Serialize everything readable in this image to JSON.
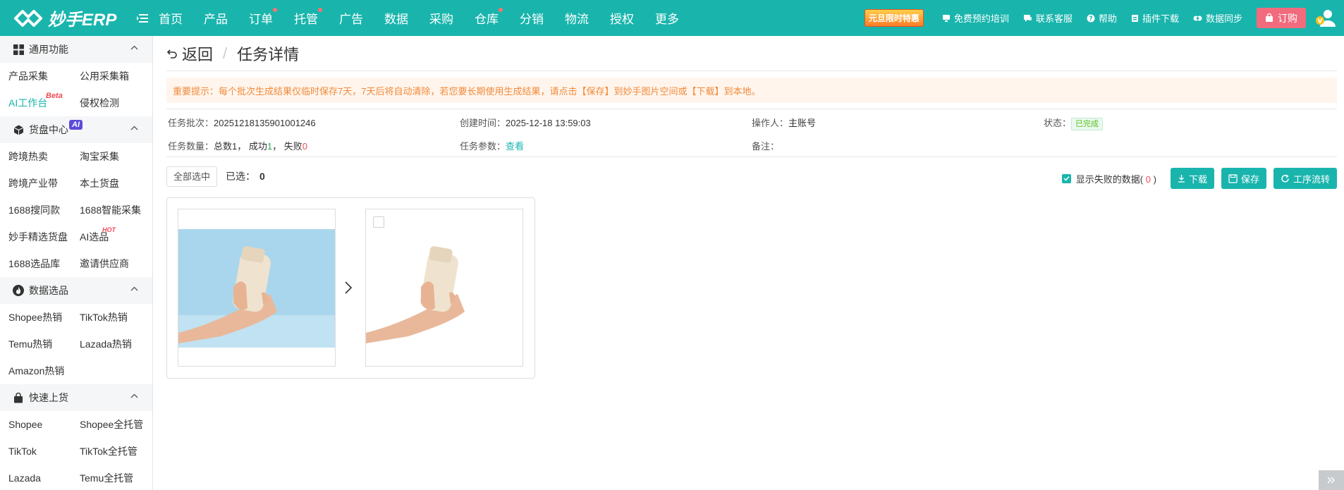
{
  "app": {
    "logo_text": "妙手ERP",
    "nav": [
      {
        "label": "首页",
        "dot": false
      },
      {
        "label": "产品",
        "dot": false
      },
      {
        "label": "订单",
        "dot": true
      },
      {
        "label": "托管",
        "dot": true
      },
      {
        "label": "广告",
        "dot": false
      },
      {
        "label": "数据",
        "dot": false
      },
      {
        "label": "采购",
        "dot": false
      },
      {
        "label": "仓库",
        "dot": true
      },
      {
        "label": "分销",
        "dot": false
      },
      {
        "label": "物流",
        "dot": false
      },
      {
        "label": "授权",
        "dot": false
      },
      {
        "label": "更多",
        "dot": false
      }
    ],
    "promo": "元旦限时特惠",
    "tools": {
      "training": "免费预约培训",
      "support": "联系客服",
      "help": "帮助",
      "plugin": "插件下载",
      "sync": "数据同步",
      "order": "订购"
    },
    "colors": {
      "primary": "#19b5ad",
      "order": "#f16b7d",
      "warn": "#f08a3c",
      "danger": "#f04a55"
    }
  },
  "sidebar": {
    "sections": [
      {
        "title": "通用功能",
        "icon": "grid-icon",
        "items": [
          "产品采集",
          "公用采集箱",
          "AI工作台",
          "侵权检测"
        ]
      },
      {
        "title": "货盘中心",
        "icon": "cube-icon",
        "badge": "AI",
        "items": [
          "跨境热卖",
          "淘宝采集",
          "跨境产业带",
          "本土货盘",
          "1688搜同款",
          "1688智能采集",
          "妙手精选货盘",
          "AI选品",
          "1688选品库",
          "邀请供应商"
        ]
      },
      {
        "title": "数据选品",
        "icon": "flame-icon",
        "items": [
          "Shopee热销",
          "TikTok热销",
          "Temu热销",
          "Lazada热销",
          "Amazon热销"
        ]
      },
      {
        "title": "快速上货",
        "icon": "bag-icon",
        "items": [
          "Shopee",
          "Shopee全托管",
          "TikTok",
          "TikTok全托管",
          "Lazada",
          "Temu全托管"
        ]
      }
    ],
    "sup_beta": "Beta",
    "sup_hot": "HOT"
  },
  "page": {
    "back": "返回",
    "title": "任务详情",
    "notice": "重要提示：每个批次生成结果仅临时保存7天，7天后将自动清除，若您要长期使用生成结果，请点击【保存】到妙手图片空间或【下载】到本地。",
    "info": {
      "batch_label": "任务批次：",
      "batch_value": "20251218135901001246",
      "created_label": "创建时间：",
      "created_value": "2025-12-18 13:59:03",
      "operator_label": "操作人：",
      "operator_value": "主账号",
      "status_label": "状态：",
      "status_value": "已完成",
      "count_label": "任务数量：",
      "count_total": "总数1，",
      "count_success_label": "成功",
      "count_success": "1",
      "count_sep": "，",
      "count_fail_label": "失败",
      "count_fail": "0",
      "params_label": "任务参数：",
      "params_link": "查看",
      "remark_label": "备注："
    },
    "toolbar": {
      "select_all": "全部选中",
      "selected_label": "已选：",
      "selected_count": "0",
      "show_failed": "显示失败的数据(",
      "failed_count": "0",
      "show_failed_end": ")",
      "download": "下载",
      "save": "保存",
      "workflow": "工序流转"
    }
  }
}
